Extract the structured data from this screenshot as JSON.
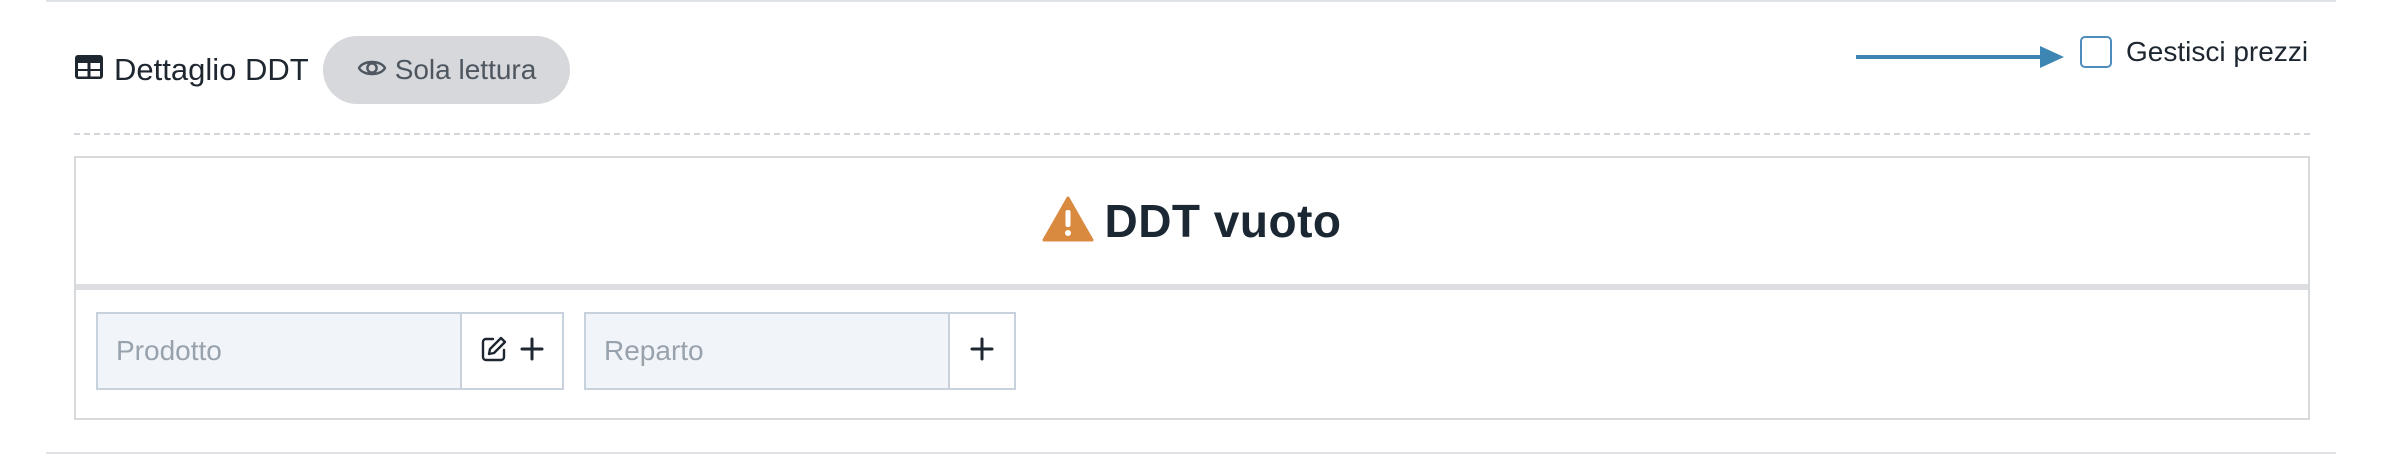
{
  "header": {
    "title": "Dettaglio DDT",
    "badge": "Sola lettura"
  },
  "pricing": {
    "checkbox_label": "Gestisci prezzi",
    "checked": false
  },
  "panel": {
    "empty_message": "DDT vuoto"
  },
  "inputs": {
    "product_placeholder": "Prodotto",
    "department_placeholder": "Reparto"
  },
  "icons": {
    "title_icon": "table-icon",
    "badge_icon": "eye-icon",
    "empty_icon": "warning-icon",
    "edit_icon": "edit-icon",
    "add_icon": "plus-icon",
    "pointer": "arrow-right-icon"
  },
  "colors": {
    "accent": "#4d8dbd",
    "arrow": "#3d86b3",
    "warning": "#d98a3f",
    "badge_bg": "#d6d8db",
    "input_bg": "#f1f4f8"
  }
}
